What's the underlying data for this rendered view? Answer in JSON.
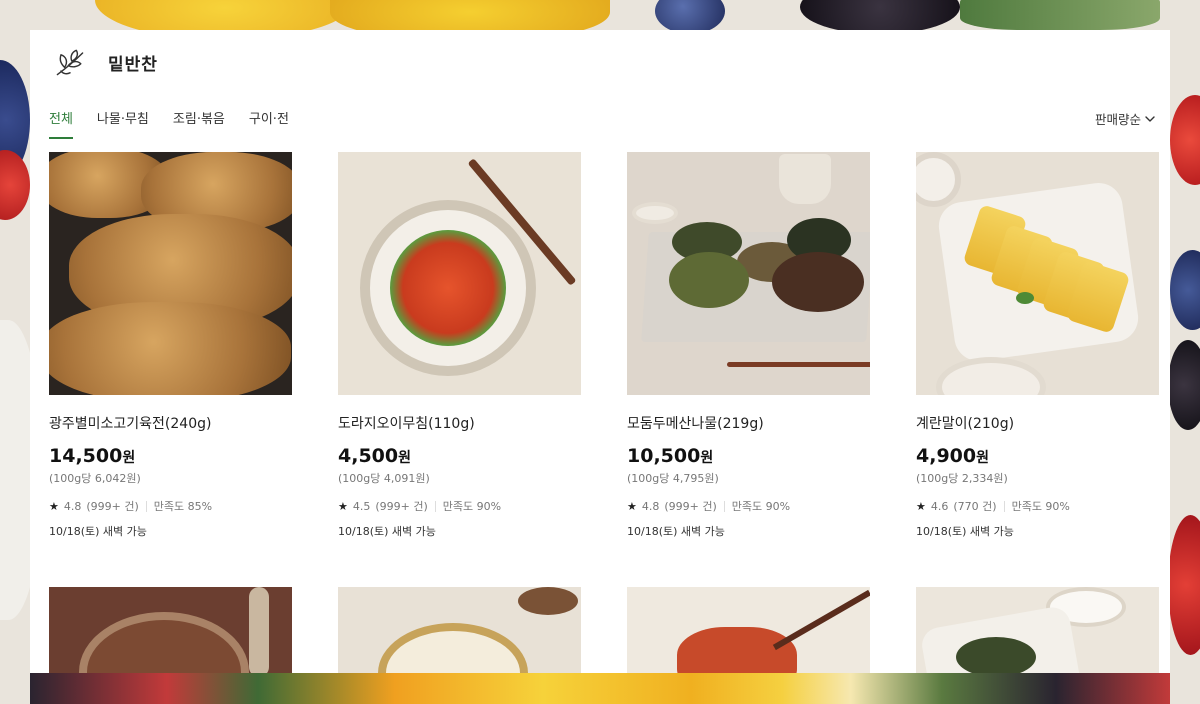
{
  "page": {
    "title": "밑반찬"
  },
  "tabs": [
    {
      "label": "전체",
      "active": true
    },
    {
      "label": "나물·무침",
      "active": false
    },
    {
      "label": "조림·볶음",
      "active": false
    },
    {
      "label": "구이·전",
      "active": false
    }
  ],
  "sort": {
    "label": "판매량순",
    "icon": "chevron-down-icon"
  },
  "colors": {
    "accent": "#2e7d3a"
  },
  "products": [
    {
      "name": "광주별미소고기육전(240g)",
      "price": "14,500",
      "currency": "원",
      "unit_price": "(100g당 6,042원)",
      "rating": "4.8",
      "reviews": "(999+ 건)",
      "satisfaction": "만족도 85%",
      "delivery": "10/18(토) 새벽 가능",
      "image": "beef-pancake"
    },
    {
      "name": "도라지오이무침(110g)",
      "price": "4,500",
      "currency": "원",
      "unit_price": "(100g당 4,091원)",
      "rating": "4.5",
      "reviews": "(999+ 건)",
      "satisfaction": "만족도 90%",
      "delivery": "10/18(토) 새벽 가능",
      "image": "bellflower-cucumber"
    },
    {
      "name": "모둠두메산나물(219g)",
      "price": "10,500",
      "currency": "원",
      "unit_price": "(100g당 4,795원)",
      "rating": "4.8",
      "reviews": "(999+ 건)",
      "satisfaction": "만족도 90%",
      "delivery": "10/18(토) 새벽 가능",
      "image": "mountain-greens"
    },
    {
      "name": "계란말이(210g)",
      "price": "4,900",
      "currency": "원",
      "unit_price": "(100g당 2,334원)",
      "rating": "4.6",
      "reviews": "(770 건)",
      "satisfaction": "만족도 90%",
      "delivery": "10/18(토) 새벽 가능",
      "image": "rolled-omelette"
    }
  ]
}
